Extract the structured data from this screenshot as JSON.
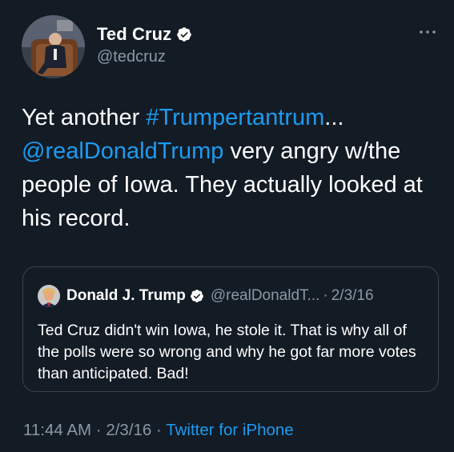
{
  "author": {
    "display_name": "Ted Cruz",
    "handle": "@tedcruz",
    "verified": true,
    "avatar": "person-on-chair-avatar"
  },
  "more_icon": "more-horizontal-icon",
  "tweet": {
    "text_segments": [
      {
        "text": "Yet another ",
        "type": "text"
      },
      {
        "text": "#Trumpertantrum",
        "type": "hashtag"
      },
      {
        "text": "...",
        "type": "text"
      },
      {
        "text": "@realDonaldTrump",
        "type": "mention"
      },
      {
        "text": " very angry w/the people of Iowa. They actually looked at his record.",
        "type": "text"
      }
    ]
  },
  "quote": {
    "display_name": "Donald J. Trump",
    "verified": true,
    "handle": "@realDonaldT...",
    "separator": "·",
    "date": "2/3/16",
    "text": "Ted Cruz didn't win Iowa, he stole it. That is why all of the polls were so wrong and why he got far more votes than anticipated. Bad!",
    "avatar": "trump-avatar"
  },
  "footer": {
    "time": "11:44 AM",
    "separator": "·",
    "date": "2/3/16",
    "source": "Twitter for iPhone"
  },
  "colors": {
    "background": "#131b25",
    "link": "#1d9bf0",
    "secondary_text": "#8b98a5",
    "border": "#38444d"
  }
}
